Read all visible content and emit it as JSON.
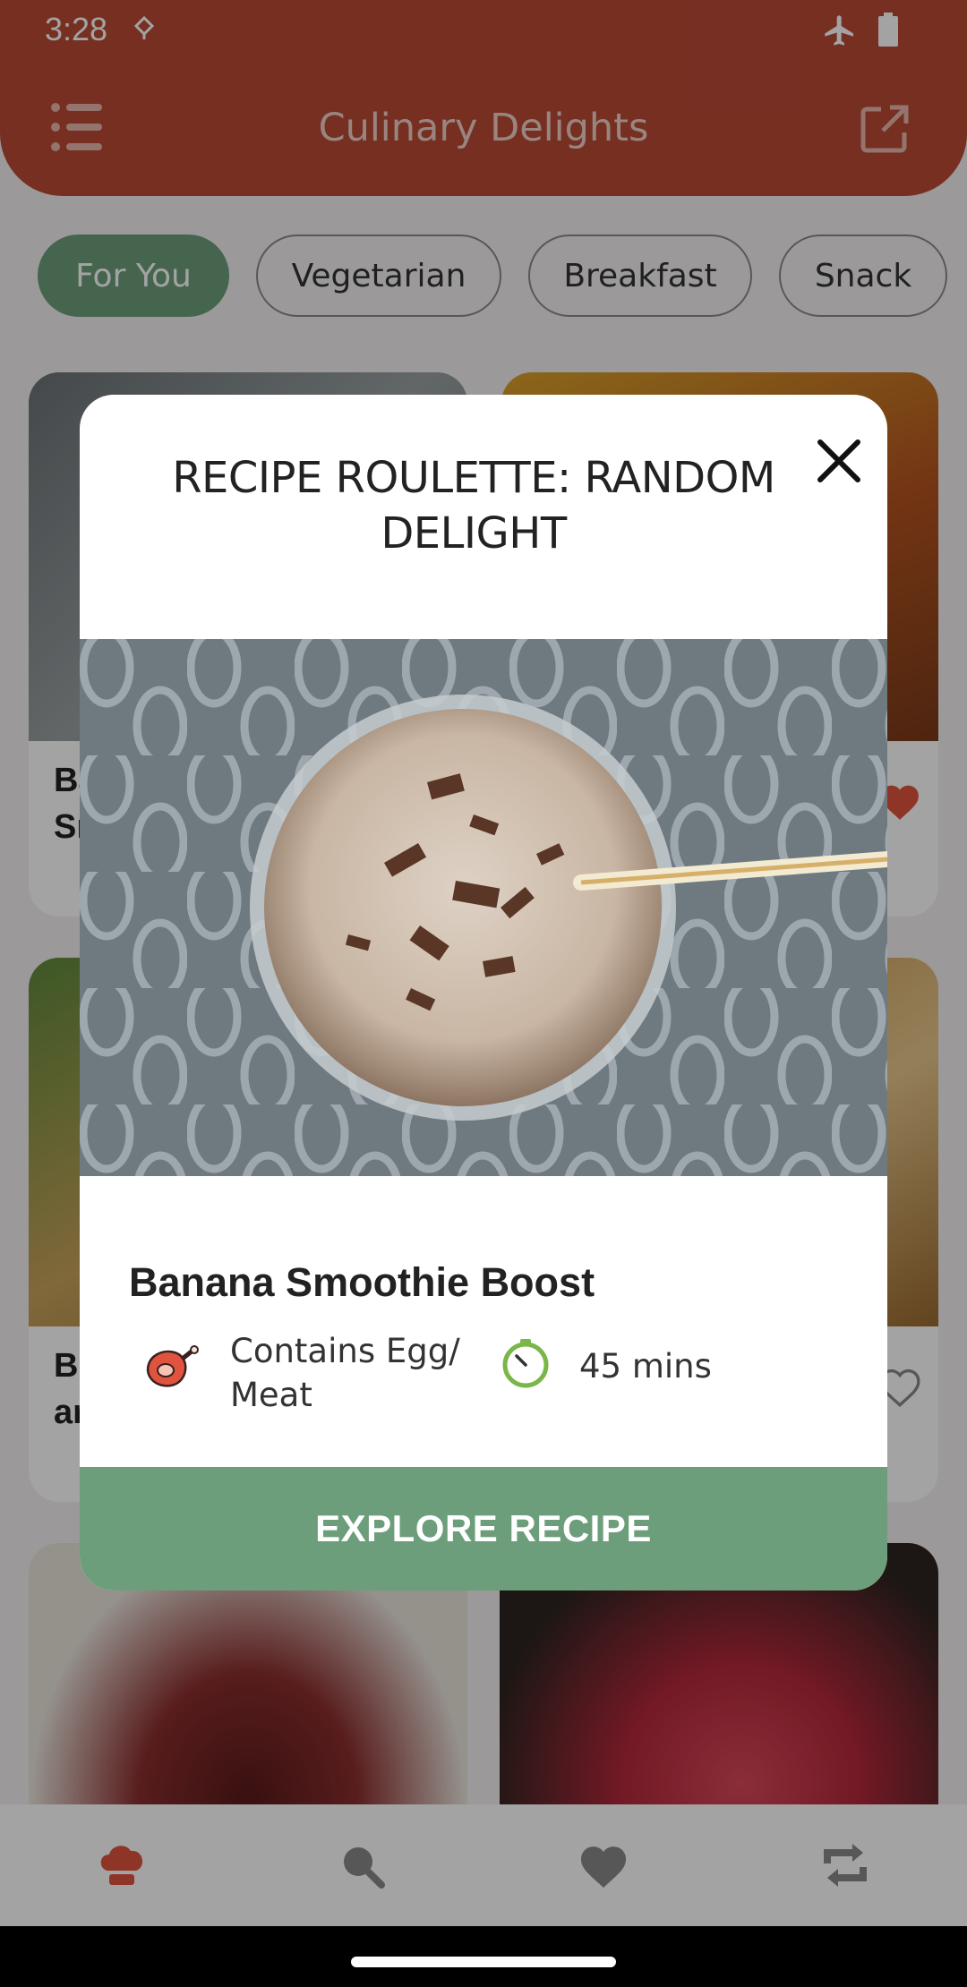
{
  "status_bar": {
    "time": "3:28"
  },
  "app_bar": {
    "title": "Culinary Delights"
  },
  "filter_chips": [
    {
      "label": "For You",
      "active": true
    },
    {
      "label": "Vegetarian",
      "active": false
    },
    {
      "label": "Breakfast",
      "active": false
    },
    {
      "label": "Snack",
      "active": false
    }
  ],
  "background_cards": [
    {
      "partial_title": "Ba\nSr"
    },
    {
      "partial_title": "B\nar"
    }
  ],
  "bottom_nav": [
    {
      "icon": "chef-hat-icon",
      "active": true
    },
    {
      "icon": "search-icon",
      "active": false
    },
    {
      "icon": "heart-icon",
      "active": false
    },
    {
      "icon": "refresh-icon",
      "active": false
    }
  ],
  "dialog": {
    "title": "RECIPE ROULETTE: RANDOM DELIGHT",
    "recipe_name": "Banana Smoothie Boost",
    "diet_label": "Contains Egg/ Meat",
    "time_label": "45 mins",
    "button_label": "EXPLORE RECIPE"
  },
  "colors": {
    "primary": "#b94a35",
    "accent_green": "#6d9e7b",
    "timer_green": "#7ab648"
  }
}
